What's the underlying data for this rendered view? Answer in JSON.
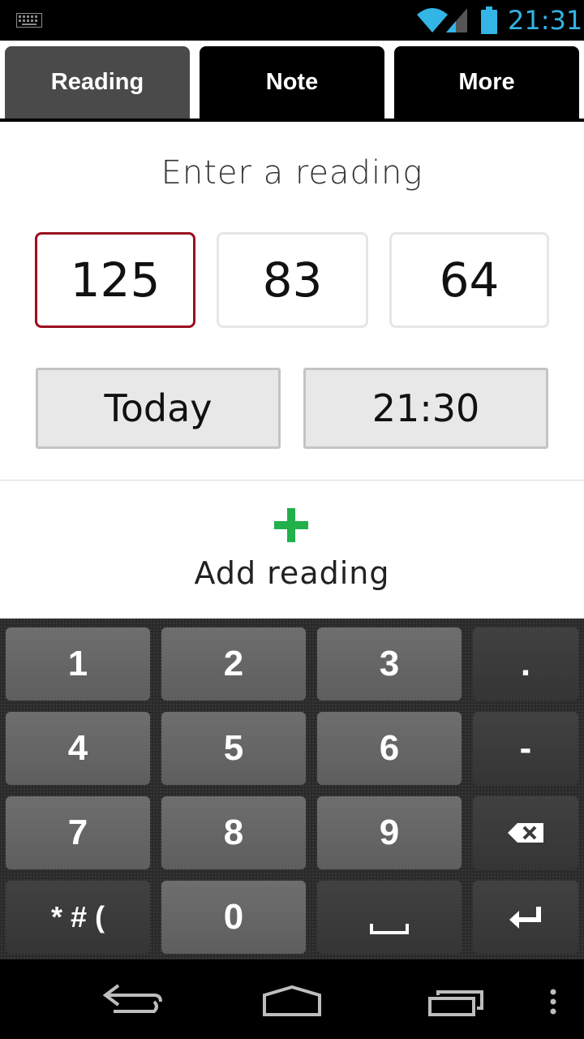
{
  "status_bar": {
    "time": "21:31",
    "icons": [
      "keyboard-icon",
      "wifi-icon",
      "signal-icon",
      "battery-icon"
    ],
    "clock_color": "#33b5e5"
  },
  "tabs": [
    {
      "label": "Reading",
      "active": true
    },
    {
      "label": "Note",
      "active": false
    },
    {
      "label": "More",
      "active": false
    }
  ],
  "form": {
    "heading": "Enter a reading",
    "systolic": "125",
    "diastolic": "83",
    "pulse": "64",
    "date_label": "Today",
    "time_label": "21:30",
    "focus_color": "#9a1020"
  },
  "add": {
    "label": "Add reading",
    "icon": "plus-icon",
    "icon_color": "#22b04b"
  },
  "keyboard": {
    "rows": [
      [
        "1",
        "2",
        "3",
        "."
      ],
      [
        "4",
        "5",
        "6",
        "-"
      ],
      [
        "7",
        "8",
        "9",
        "backspace-icon"
      ],
      [
        "*#(",
        "0",
        "space-icon",
        "enter-icon"
      ]
    ],
    "symbols_label": "* # ("
  },
  "nav": [
    "back-icon",
    "home-icon",
    "recent-apps-icon",
    "menu-icon"
  ]
}
